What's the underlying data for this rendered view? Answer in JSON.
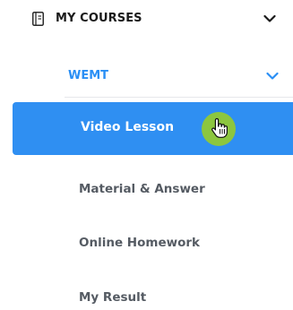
{
  "menu": {
    "section_title": "MY COURSES",
    "section_icon": "book-icon",
    "course": {
      "label": "WEMT",
      "accent_color": "#2a8ff5"
    },
    "active_item": {
      "label": "Video Lesson",
      "background_color": "#2f8ff2"
    },
    "items": [
      {
        "label": "Material & Answer"
      },
      {
        "label": "Online Homework"
      },
      {
        "label": "My Result"
      }
    ]
  },
  "cursor": {
    "icon": "hand-pointer-icon",
    "highlight_color": "#8cc63f"
  }
}
